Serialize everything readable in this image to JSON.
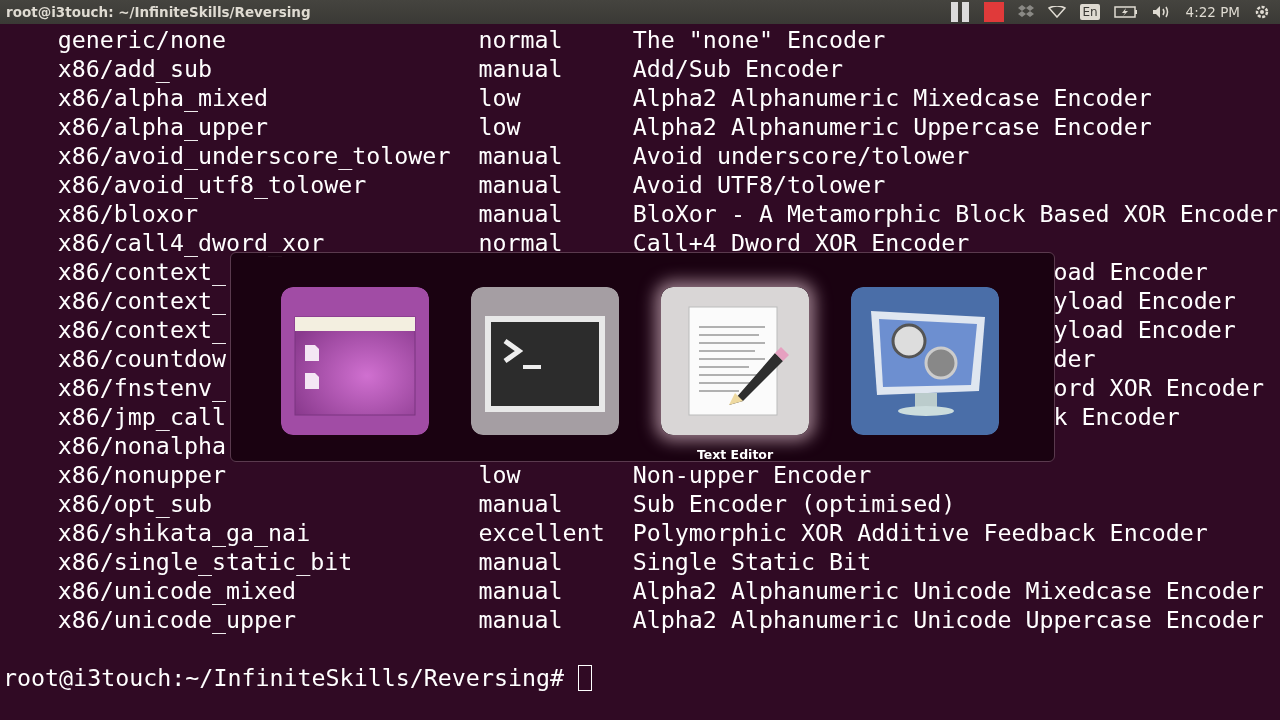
{
  "top_bar": {
    "title": "root@i3touch: ~/InfiniteSkills/Reversing",
    "keyboard": "En",
    "clock": "4:22 PM"
  },
  "terminal": {
    "rows": [
      {
        "kind": "full",
        "name": "generic/none",
        "rank": "normal",
        "description": "The \"none\" Encoder"
      },
      {
        "kind": "full",
        "name": "x86/add_sub",
        "rank": "manual",
        "description": "Add/Sub Encoder"
      },
      {
        "kind": "full",
        "name": "x86/alpha_mixed",
        "rank": "low",
        "description": "Alpha2 Alphanumeric Mixedcase Encoder"
      },
      {
        "kind": "full",
        "name": "x86/alpha_upper",
        "rank": "low",
        "description": "Alpha2 Alphanumeric Uppercase Encoder"
      },
      {
        "kind": "full",
        "name": "x86/avoid_underscore_tolower",
        "rank": "manual",
        "description": "Avoid underscore/tolower"
      },
      {
        "kind": "full",
        "name": "x86/avoid_utf8_tolower",
        "rank": "manual",
        "description": "Avoid UTF8/tolower"
      },
      {
        "kind": "full",
        "name": "x86/bloxor",
        "rank": "manual",
        "description": "BloXor - A Metamorphic Block Based XOR Encoder"
      },
      {
        "kind": "full",
        "name": "x86/call4_dword_xor",
        "rank": "normal",
        "description": "Call+4 Dword XOR Encoder"
      },
      {
        "kind": "covered",
        "name": "x86/context_",
        "tail": "oad Encoder"
      },
      {
        "kind": "covered",
        "name": "x86/context_",
        "tail": "yload Encoder"
      },
      {
        "kind": "covered",
        "name": "x86/context_",
        "tail": "yload Encoder"
      },
      {
        "kind": "covered",
        "name": "x86/countdow",
        "tail": "der"
      },
      {
        "kind": "covered",
        "name": "x86/fnstenv_",
        "tail": "ord XOR Encoder"
      },
      {
        "kind": "covered",
        "name": "x86/jmp_call",
        "tail": "k Encoder"
      },
      {
        "kind": "covered",
        "name": "x86/nonalpha"
      },
      {
        "kind": "full",
        "name": "x86/nonupper",
        "rank": "low",
        "description": "Non-upper Encoder"
      },
      {
        "kind": "full",
        "name": "x86/opt_sub",
        "rank": "manual",
        "description": "Sub Encoder (optimised)"
      },
      {
        "kind": "full",
        "name": "x86/shikata_ga_nai",
        "rank": "excellent",
        "description": "Polymorphic XOR Additive Feedback Encoder"
      },
      {
        "kind": "full",
        "name": "x86/single_static_bit",
        "rank": "manual",
        "description": "Single Static Bit"
      },
      {
        "kind": "full",
        "name": "x86/unicode_mixed",
        "rank": "manual",
        "description": "Alpha2 Alphanumeric Unicode Mixedcase Encoder"
      },
      {
        "kind": "full",
        "name": "x86/unicode_upper",
        "rank": "manual",
        "description": "Alpha2 Alphanumeric Unicode Uppercase Encoder"
      }
    ],
    "prompt": "root@i3touch:~/InfiniteSkills/Reversing# "
  },
  "app_switcher": {
    "label": "Text Editor",
    "apps": [
      {
        "kind": "files",
        "selected": false
      },
      {
        "kind": "terminal",
        "selected": false
      },
      {
        "kind": "editor",
        "selected": true
      },
      {
        "kind": "media",
        "selected": false
      }
    ]
  }
}
